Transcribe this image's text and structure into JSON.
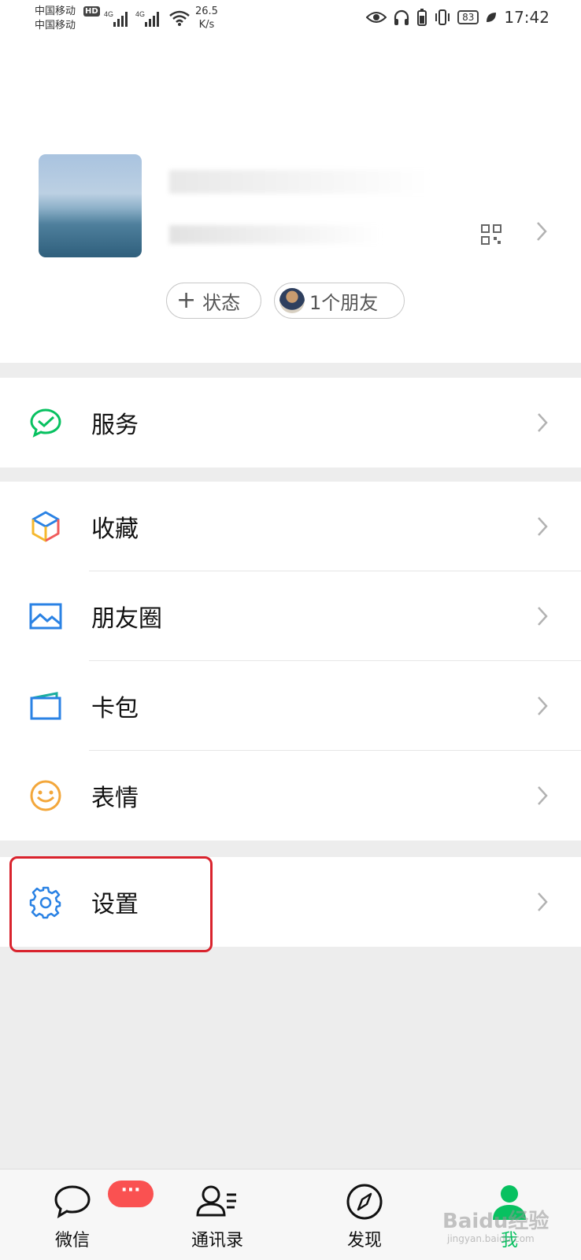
{
  "status_bar": {
    "carrier1": "中国移动",
    "carrier2": "中国移动",
    "hd": "HD",
    "net1": "4G",
    "net2": "4G",
    "speed_value": "26.5",
    "speed_unit": "K/s",
    "battery": "83",
    "time": "17:42"
  },
  "profile": {
    "status_pill": "状态",
    "friends_pill": "1个朋友"
  },
  "menu": {
    "service": "服务",
    "favorites": "收藏",
    "moments": "朋友圈",
    "cards": "卡包",
    "stickers": "表情",
    "settings": "设置"
  },
  "tabs": {
    "chats": "微信",
    "chats_badge": "···",
    "contacts": "通讯录",
    "discover": "发现",
    "me": "我"
  },
  "watermark": {
    "brand": "Baidu经验",
    "url": "jingyan.baidu.com"
  },
  "colors": {
    "accent_green": "#07c160",
    "highlight_red": "#d9232d",
    "badge_red": "#fa5151"
  }
}
